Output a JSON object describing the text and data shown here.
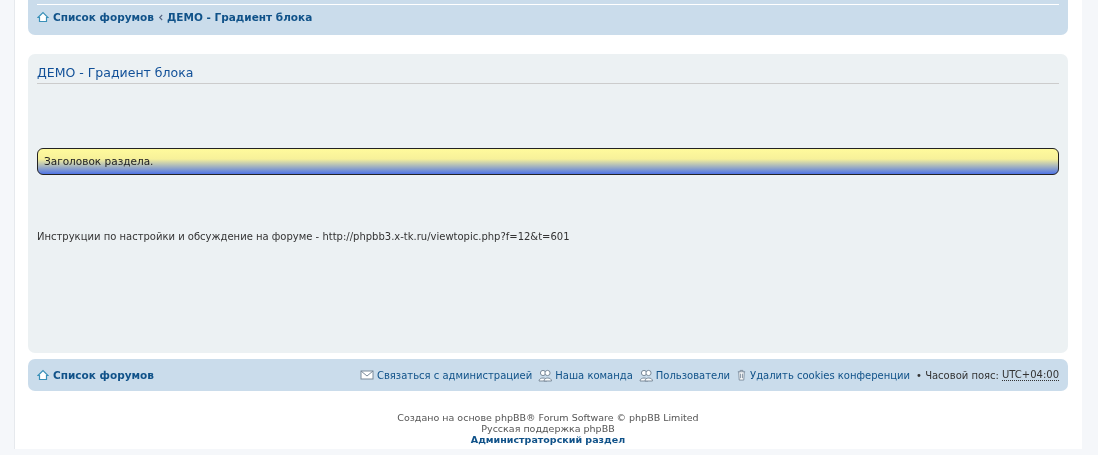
{
  "breadcrumbs": [
    {
      "kind": "home",
      "label": "Список форумов"
    },
    {
      "kind": "forum",
      "label": "ДЕМО - Градиент блока"
    }
  ],
  "panel": {
    "title": "ДЕМО - Градиент блока",
    "section_header": "Заголовок раздела.",
    "text": "Инструкции по настройки и обсуждение на форуме - http://phpbb3.x-tk.ru/viewtopic.php?f=12&t=601"
  },
  "footer_nav": {
    "home": "Список форумов",
    "links": [
      {
        "kind": "mail",
        "label": "Связаться с администрацией"
      },
      {
        "kind": "team",
        "label": "Наша команда"
      },
      {
        "kind": "team",
        "label": "Пользователи"
      },
      {
        "kind": "trash",
        "label": "Удалить cookies конференции"
      }
    ],
    "timezone_label": "• Часовой пояс:",
    "timezone": "UTC+04:00"
  },
  "copyright": [
    "Создано на основе phpBB® Forum Software © phpBB Limited",
    "Русская поддержка phpBB"
  ],
  "admin_link": "Администраторский раздел"
}
